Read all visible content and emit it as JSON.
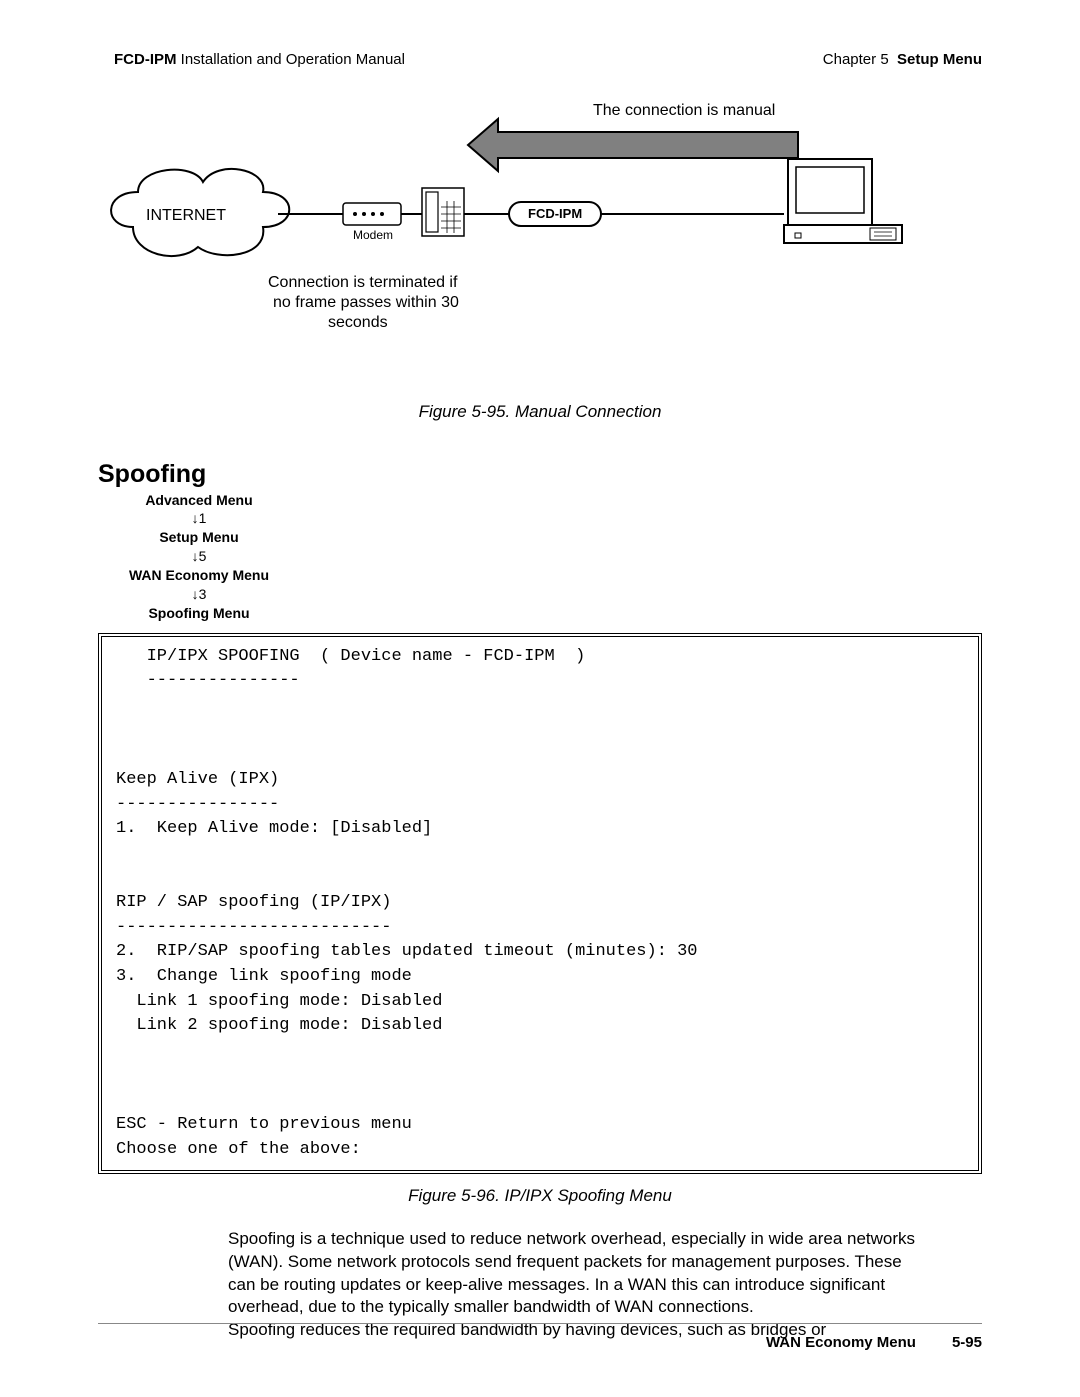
{
  "header": {
    "product": "FCD-IPM",
    "manual": "Installation and Operation Manual",
    "chapter": "Chapter 5",
    "chapter_title": "Setup Menu"
  },
  "diagram": {
    "label_top": "The connection is manual",
    "cloud": "INTERNET",
    "modem": "Modem",
    "device": "FCD-IPM",
    "note1": "Connection is terminated if",
    "note2": "no frame passes within 30",
    "note3": "seconds"
  },
  "figure95": "Figure 5-95.  Manual Connection",
  "section_heading": "Spoofing",
  "menu_path": {
    "a": "Advanced Menu",
    "s1": "↓1",
    "b": "Setup Menu",
    "s2": "↓5",
    "c": "WAN Economy Menu",
    "s3": "↓3",
    "d": "Spoofing Menu"
  },
  "terminal": "   IP/IPX SPOOFING  ( Device name - FCD-IPM  )\n   ---------------\n\n\n\nKeep Alive (IPX)\n----------------\n1.  Keep Alive mode: [Disabled]\n\n\nRIP / SAP spoofing (IP/IPX)\n---------------------------\n2.  RIP/SAP spoofing tables updated timeout (minutes): 30\n3.  Change link spoofing mode\n  Link 1 spoofing mode: Disabled\n  Link 2 spoofing mode: Disabled\n\n\n\nESC - Return to previous menu\nChoose one of the above:",
  "figure96": "Figure 5-96.  IP/IPX Spoofing Menu",
  "body": {
    "p1": "Spoofing is a technique used to reduce network overhead, especially in wide area networks (WAN). Some network protocols send frequent packets for management purposes. These can be routing updates or keep-alive messages. In a WAN this can introduce significant overhead, due to the typically smaller bandwidth of WAN connections.",
    "p2": "Spoofing reduces the required bandwidth by having devices, such as bridges or"
  },
  "footer": {
    "section": "WAN Economy Menu",
    "page": "5-95"
  }
}
